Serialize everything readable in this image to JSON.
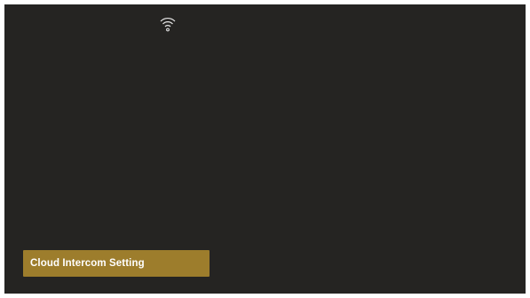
{
  "status_bar": {
    "wifi_icon": "wifi-icon"
  },
  "menu": {
    "items": [
      {
        "label": "Cloud Intercom Setting",
        "selected": true
      }
    ]
  },
  "colors": {
    "background": "#252422",
    "selected_item": "#9d7d2c",
    "text": "#ffffff"
  }
}
